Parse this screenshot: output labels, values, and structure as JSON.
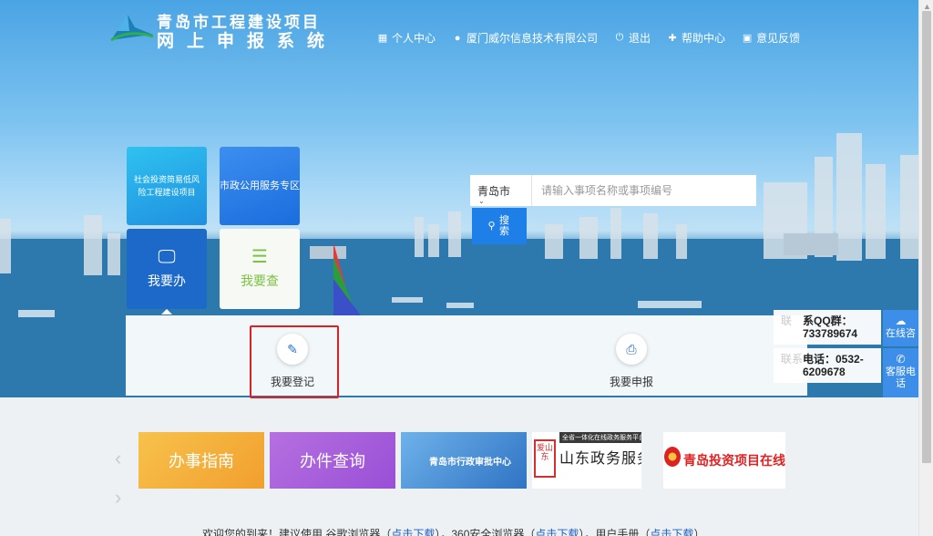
{
  "header": {
    "logo_line1": "青岛市工程建设项目",
    "logo_line2": "网上申报系统",
    "nav": [
      {
        "icon": "grid-icon",
        "label": "个人中心"
      },
      {
        "icon": "user-icon",
        "label": "厦门威尔信息技术有限公司"
      },
      {
        "icon": "power-icon",
        "label": "退出"
      },
      {
        "icon": "help-icon",
        "label": "帮助中心"
      },
      {
        "icon": "feedback-icon",
        "label": "意见反馈"
      }
    ]
  },
  "tiles": {
    "social_label": "社会投资简易低风险工程建设项目",
    "municipal_label": "市政公用服务专区",
    "do_label": "我要办",
    "check_label": "我要查"
  },
  "search": {
    "city": "青岛市",
    "placeholder": "请输入事项名称或事项编号",
    "button_label": "搜索"
  },
  "actions": {
    "register_label": "我要登记",
    "declare_label": "我要申报"
  },
  "contact": {
    "qq_faded": "联",
    "qq_text": "系QQ群：733789674",
    "phone_faded": "联系",
    "phone_text": "电话：0532-6209678"
  },
  "side": {
    "online_label": "在线咨",
    "hotline_label": "客服电话"
  },
  "banners": {
    "guide": "办事指南",
    "query": "办件查询",
    "center": "青岛市行政审批中心",
    "shandong_sub": "全省一体化在线政务服务平台",
    "shandong_main": "山东政务服务",
    "shandong_seal": "爱山东",
    "qdsp": "青岛投资项目在线审批监管平台"
  },
  "footer": {
    "text1": "欢迎您的到来！建议使用 谷歌浏览器（",
    "link1": "点击下载",
    "text2": "），360安全浏览器（",
    "link2": "点击下载",
    "text3": "），用户手册（",
    "link3": "点击下载",
    "text4": "）"
  }
}
